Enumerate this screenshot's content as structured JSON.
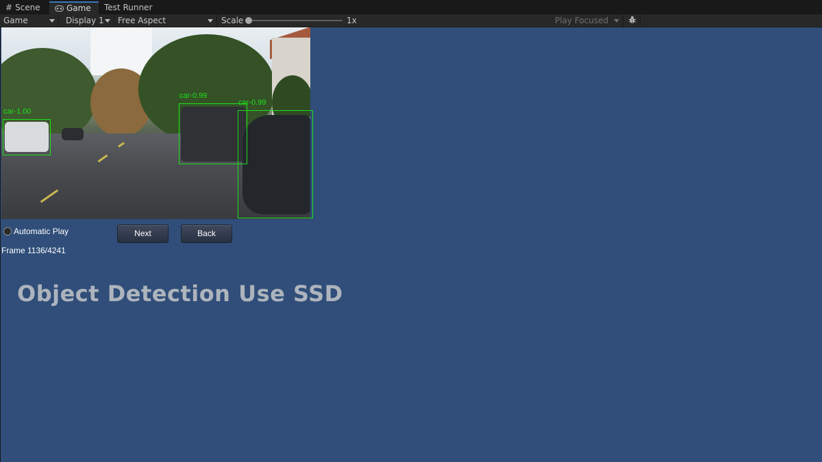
{
  "tabs": [
    {
      "icon": "grid-icon",
      "label": "Scene"
    },
    {
      "icon": "gamepad-icon",
      "label": "Game"
    },
    {
      "icon": "",
      "label": "Test Runner"
    }
  ],
  "toolbar": {
    "view_mode": "Game",
    "display": "Display 1",
    "aspect": "Free Aspect",
    "scale_label": "Scale",
    "scale_value": "1x",
    "play_mode": "Play Focused",
    "debug_icon": "bug-icon"
  },
  "detections": [
    {
      "label": "car-1.00"
    },
    {
      "label": "car-0.99"
    },
    {
      "label": "car-0.99"
    }
  ],
  "controls": {
    "automatic_play_label": "Automatic Play",
    "automatic_play_checked": false,
    "next_label": "Next",
    "back_label": "Back",
    "frame_text": "Frame 1136/4241"
  },
  "title": "Object Detection Use SSD",
  "colors": {
    "game_background": "#304e79",
    "bbox": "#1fe01f",
    "accent": "#3a79bb"
  }
}
